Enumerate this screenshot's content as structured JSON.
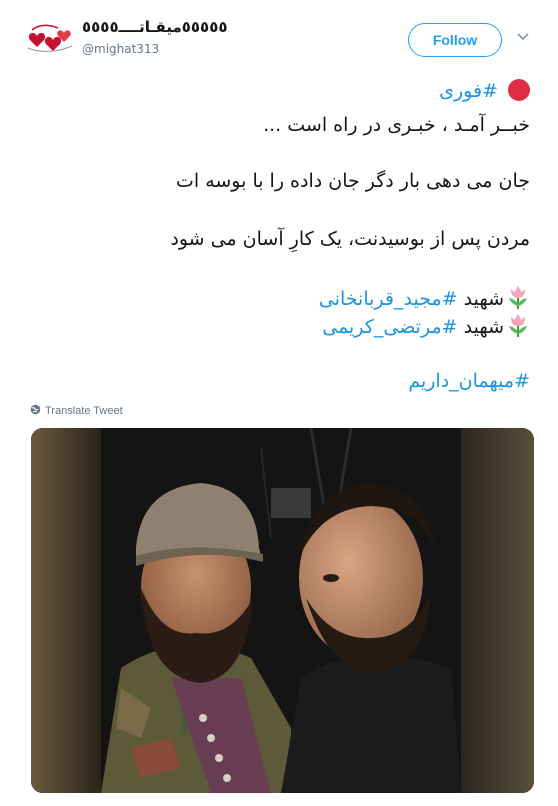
{
  "user": {
    "display_name": "٥٥٥٥٥میقـاتــــ٥٥٥٥",
    "handle": "@mighat313",
    "avatar_icon": "hearts-logo-icon"
  },
  "header": {
    "follow_label": "Follow",
    "menu_icon": "chevron-down-icon"
  },
  "tweet": {
    "line1_hashtag": "#فوری",
    "line2": "خبــر آمـد ، خبـری در راه است ...",
    "line3": "جان می دهی بار دگر جان داده را با بوسه ات",
    "line4": "مردن پس از بوسیدنت، یک کارِ آسان می شود",
    "martyr_word": "شهید",
    "martyr1_hashtag": "#مجید_قربانخانی",
    "martyr2_hashtag": "#مرتضی_کریمی",
    "final_hashtag": "#میهمان_داریم"
  },
  "translate": {
    "label": "Translate Tweet",
    "icon": "globe-icon"
  },
  "colors": {
    "link": "#1b95e0",
    "follow": "#1da1f2",
    "red_dot": "#dd2e44",
    "muted": "#657786"
  }
}
